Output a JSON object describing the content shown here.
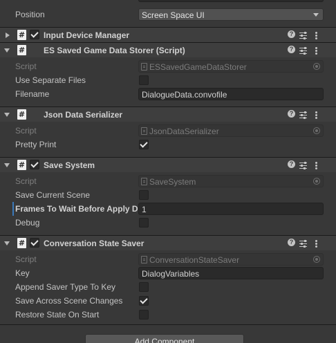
{
  "top": {
    "position_label": "Position",
    "position_value": "Screen Space UI"
  },
  "components": [
    {
      "title": "Input Device Manager",
      "expanded": false,
      "enabled": true,
      "icon": "script-icon"
    },
    {
      "title": "ES Saved Game Data Storer (Script)",
      "expanded": true,
      "enabled": null,
      "icon": "script-icon",
      "fields": {
        "script_label": "Script",
        "script_value": "ESSavedGameDataStorer",
        "use_separate_files_label": "Use Separate Files",
        "use_separate_files_value": false,
        "filename_label": "Filename",
        "filename_value": "DialogueData.convofile"
      }
    },
    {
      "title": "Json Data Serializer",
      "expanded": true,
      "enabled": null,
      "icon": "script-icon",
      "fields": {
        "script_label": "Script",
        "script_value": "JsonDataSerializer",
        "pretty_print_label": "Pretty Print",
        "pretty_print_value": true
      }
    },
    {
      "title": "Save System",
      "expanded": true,
      "enabled": true,
      "icon": "script-icon",
      "fields": {
        "script_label": "Script",
        "script_value": "SaveSystem",
        "save_current_scene_label": "Save Current Scene",
        "save_current_scene_value": false,
        "frames_label": "Frames To Wait Before Apply D",
        "frames_value": "1",
        "debug_label": "Debug",
        "debug_value": false
      }
    },
    {
      "title": "Conversation State Saver",
      "expanded": true,
      "enabled": true,
      "icon": "script-icon",
      "fields": {
        "script_label": "Script",
        "script_value": "ConversationStateSaver",
        "key_label": "Key",
        "key_value": "DialogVariables",
        "append_label": "Append Saver Type To Key",
        "append_value": false,
        "save_across_label": "Save Across Scene Changes",
        "save_across_value": true,
        "restore_label": "Restore State On Start",
        "restore_value": false
      }
    }
  ],
  "add_component_label": "Add Component",
  "colors": {
    "background": "#383838",
    "header": "#3e3e3e",
    "field": "#2a2a2a",
    "focus_accent": "#3a79bb"
  }
}
